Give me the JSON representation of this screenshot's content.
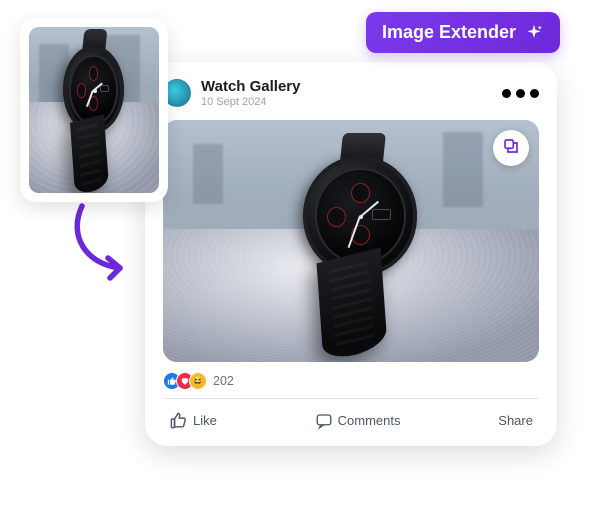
{
  "badge": {
    "label": "Image Extender"
  },
  "post": {
    "profile_name": "Watch Gallery",
    "date": "10 Sept 2024",
    "reaction_count": "202"
  },
  "actions": {
    "like": "Like",
    "comments": "Comments",
    "share": "Share"
  },
  "icons": {
    "sparkle": "sparkle-icon",
    "extend": "extend-icon",
    "thumbs_up": "thumbs-up-icon",
    "comment": "comment-icon"
  }
}
